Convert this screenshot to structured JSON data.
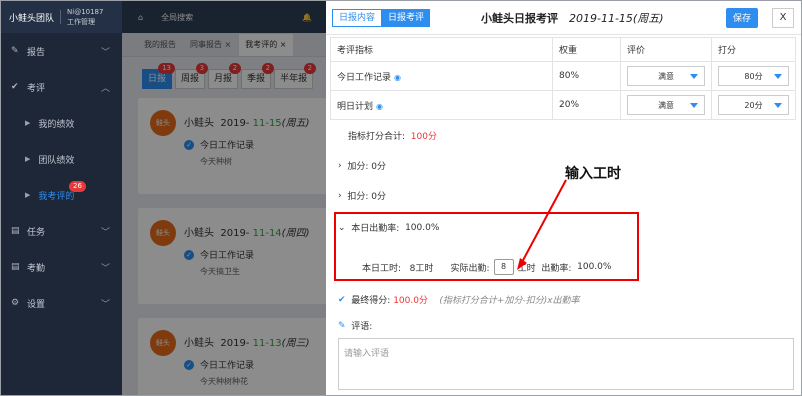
{
  "sidebar": {
    "brand": "小鲑头团队",
    "user": "Ni@10187",
    "role": "工作管理",
    "items": [
      {
        "label": "报告",
        "icon": "edit-icon"
      },
      {
        "label": "考评",
        "icon": "check-icon"
      }
    ],
    "sub": [
      {
        "label": "我的绩效"
      },
      {
        "label": "团队绩效"
      },
      {
        "label": "我考评的",
        "badge": "26"
      }
    ],
    "items2": [
      {
        "label": "任务",
        "icon": "list-icon"
      },
      {
        "label": "考勤",
        "icon": "list-icon"
      },
      {
        "label": "设置",
        "icon": "gear-icon"
      }
    ]
  },
  "topbar": {
    "search": "全局搜索"
  },
  "tabs": [
    {
      "label": "我的报告"
    },
    {
      "label": "同事报告",
      "close": "×"
    },
    {
      "label": "我考评的",
      "close": "×"
    }
  ],
  "subtabs": [
    {
      "label": "日报",
      "badge": "13"
    },
    {
      "label": "周报",
      "badge": "3"
    },
    {
      "label": "月报",
      "badge": "2"
    },
    {
      "label": "季报",
      "badge": "2"
    },
    {
      "label": "半年报",
      "badge": "2"
    }
  ],
  "cards": [
    {
      "avatar": "鲑头",
      "name": "小鲑头",
      "date_prefix": "2019- ",
      "date_hl": "11-15",
      "weekday": "(周五)",
      "record": "今日工作记录",
      "content": "今天种树"
    },
    {
      "avatar": "鲑头",
      "name": "小鲑头",
      "date_prefix": "2019- ",
      "date_hl": "11-14",
      "weekday": "(周四)",
      "record": "今日工作记录",
      "content": "今天搞卫生"
    },
    {
      "avatar": "鲑头",
      "name": "小鲑头",
      "date_prefix": "2019- ",
      "date_hl": "11-13",
      "weekday": "(周三)",
      "record": "今日工作记录",
      "content": "今天种树种花"
    }
  ],
  "panel": {
    "tab1": "日报内容",
    "tab2": "日报考评",
    "title": "小鲑头日报考评",
    "date": "2019-11-15(周五)",
    "save": "保存",
    "close": "X",
    "headers": [
      "考评指标",
      "权重",
      "评价",
      "打分"
    ],
    "rows": [
      {
        "name": "今日工作记录",
        "weight": "80%",
        "eval": "满意",
        "score": "80分"
      },
      {
        "name": "明日计划",
        "weight": "20%",
        "eval": "满意",
        "score": "20分"
      }
    ],
    "total_label": "指标打分合计:",
    "total_value": "100分",
    "bonus_label": "加分:",
    "bonus_value": "0分",
    "deduct_label": "扣分:",
    "deduct_value": "0分",
    "attendance_label": "本日出勤率:",
    "attendance_value": "100.0%",
    "work_hours_label": "本日工时:",
    "work_hours_value": "8工时",
    "actual_label": "实际出勤:",
    "actual_input": "8",
    "actual_unit": "工时",
    "rate_label": "出勤率:",
    "rate_value": "100.0%",
    "final_label": "最终得分:",
    "final_value": "100.0分",
    "formula": "(指标打分合计+加分-扣分)x出勤率",
    "comment_label": "评语:",
    "comment_placeholder": "请输入评语"
  },
  "annotation": "输入工时"
}
